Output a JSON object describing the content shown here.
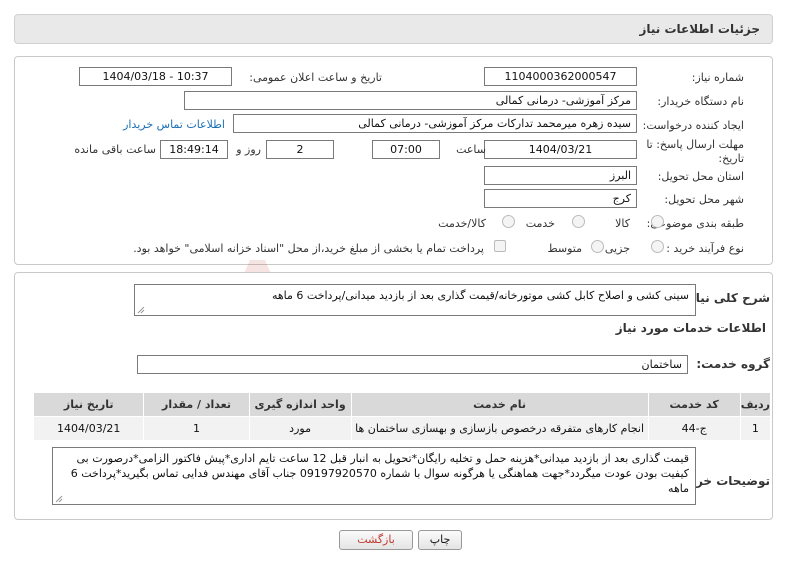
{
  "title": "جزئیات اطلاعات نیاز",
  "fields": {
    "need_number_label": "شماره نیاز:",
    "need_number": "1104000362000547",
    "announce_label": "تاریخ و ساعت اعلان عمومی:",
    "announce_value": "1404/03/18 - 10:37",
    "buyer_label": "نام دستگاه خریدار:",
    "buyer_value": "مرکز آموزشی- درمانی کمالی",
    "requester_label": "ایجاد کننده درخواست:",
    "requester_value": "سیده زهره میرمحمد تدارکات مرکز آموزشی- درمانی کمالی",
    "contact_link": "اطلاعات تماس خریدار",
    "deadline_label_1": "مهلت ارسال پاسخ: تا",
    "deadline_label_2": "تاریخ:",
    "deadline_date": "1404/03/21",
    "time_label": "ساعت",
    "deadline_time": "07:00",
    "days_value": "2",
    "days_label": "روز و",
    "remaining_time": "18:49:14",
    "remaining_label": "ساعت باقی مانده",
    "province_label": "استان محل تحویل:",
    "province_value": "البرز",
    "city_label": "شهر محل تحویل:",
    "city_value": "کرج",
    "category_label": "طبقه بندی موضوعی:",
    "category_options": [
      "کالا",
      "خدمت",
      "کالا/خدمت"
    ],
    "process_label": "نوع فرآیند خرید :",
    "process_options": [
      "جزیی",
      "متوسط"
    ],
    "payment_note": "پرداخت تمام یا بخشی از مبلغ خرید،از محل \"اسناد خزانه اسلامی\" خواهد بود."
  },
  "summary_label": "شرح کلی نیاز:",
  "summary_text": "سینی کشی و اصلاح کابل کشی موتورخانه/قیمت گذاری بعد از بازدید میدانی/پرداخت 6 ماهه",
  "services_heading": "اطلاعات خدمات مورد نیاز",
  "service_group_label": "گروه خدمت:",
  "service_group_value": "ساختمان",
  "table": {
    "headers": [
      "ردیف",
      "کد خدمت",
      "نام خدمت",
      "واحد اندازه گیری",
      "تعداد / مقدار",
      "تاریخ نیاز"
    ],
    "rows": [
      [
        "1",
        "ج-44",
        "انجام کارهای متفرقه درخصوص بازسازی و بهسازی ساختمان ها",
        "مورد",
        "1",
        "1404/03/21"
      ]
    ]
  },
  "buyer_notes_label": "توضیحات خریدار:",
  "buyer_notes": "قیمت گذاری بعد از بازدید میدانی*هزینه حمل و تخلیه رایگان*تحویل به انبار قبل 12 ساعت تایم اداری*پیش فاکتور الزامی*درصورت بی کیفیت بودن عودت میگردد*جهت هماهنگی یا هرگونه سوال با شماره 09197920570 جناب آقای مهندس فدایی تماس بگیرید*پرداخت 6 ماهه",
  "buttons": {
    "print": "چاپ",
    "back": "بازگشت"
  },
  "watermark_text": "AriaTender.net",
  "colors": {
    "link": "#1a6fb5",
    "back_button_text": "#c0392b",
    "watermark": "#c0392b"
  }
}
